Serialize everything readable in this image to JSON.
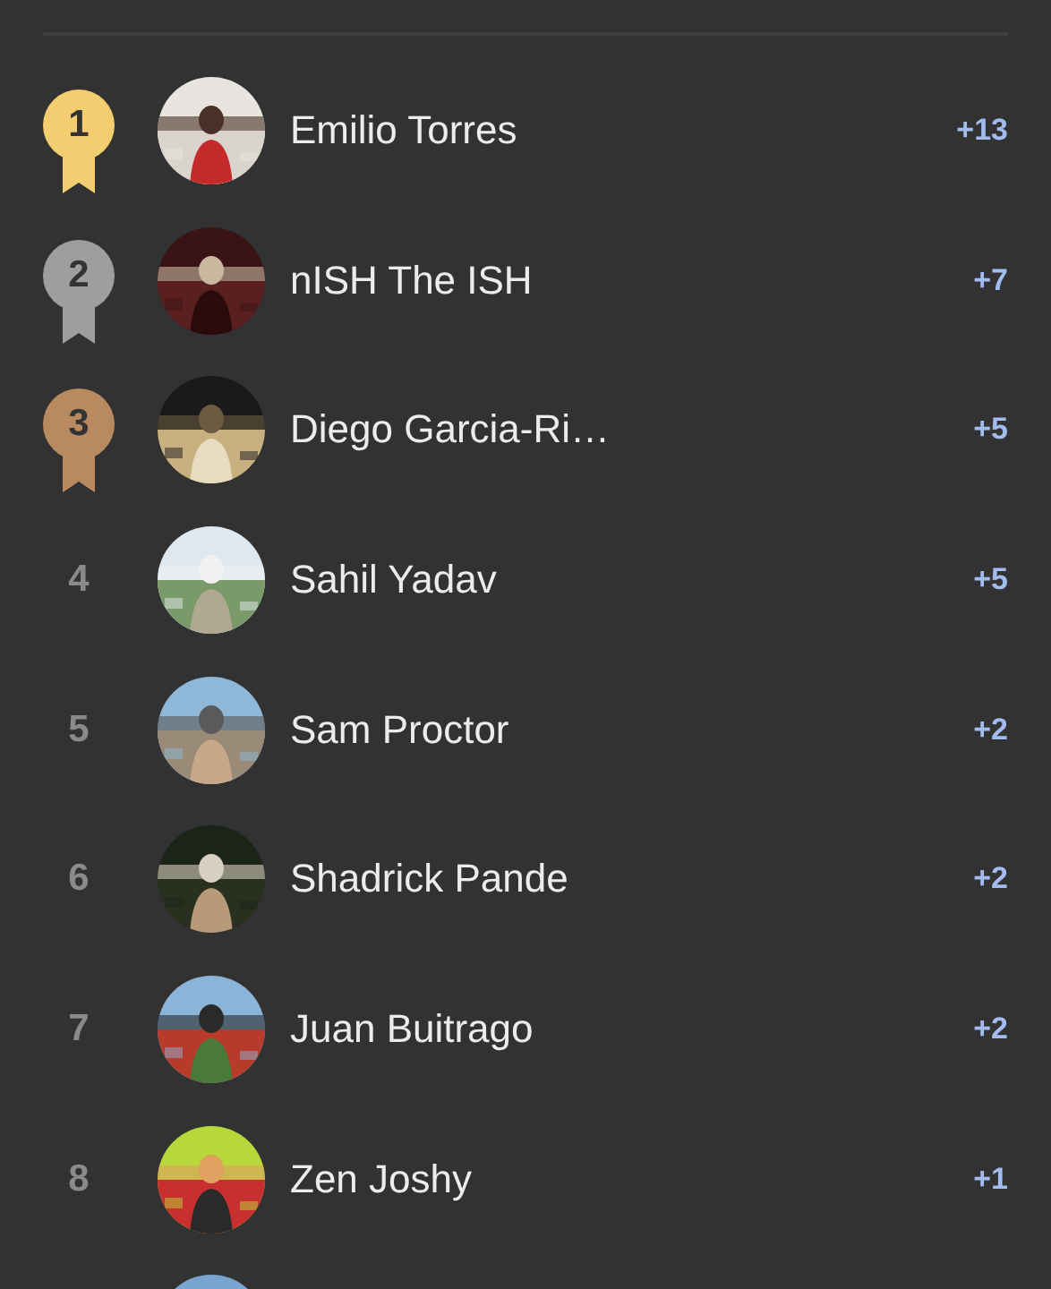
{
  "leaderboard": {
    "rows": [
      {
        "rank": "1",
        "kind": "medal",
        "color": "#f3cd70",
        "name": "Emilio Torres",
        "score": "+13",
        "avatar": {
          "kind": "picture"
        }
      },
      {
        "rank": "2",
        "kind": "medal",
        "color": "#9e9e9e",
        "name": "nISH The ISH",
        "score": "+7",
        "avatar": {
          "kind": "picture"
        }
      },
      {
        "rank": "3",
        "kind": "medal",
        "color": "#b98a5f",
        "name": "Diego Garcia-Ri…",
        "score": "+5",
        "avatar": {
          "kind": "picture"
        }
      },
      {
        "rank": "4",
        "kind": "plain",
        "name": "Sahil Yadav",
        "score": "+5",
        "avatar": {
          "kind": "picture"
        }
      },
      {
        "rank": "5",
        "kind": "plain",
        "name": "Sam Proctor",
        "score": "+2",
        "avatar": {
          "kind": "picture"
        }
      },
      {
        "rank": "6",
        "kind": "plain",
        "name": "Shadrick Pande",
        "score": "+2",
        "avatar": {
          "kind": "picture"
        }
      },
      {
        "rank": "7",
        "kind": "plain",
        "name": "Juan Buitrago",
        "score": "+2",
        "avatar": {
          "kind": "picture"
        }
      },
      {
        "rank": "8",
        "kind": "plain",
        "name": "Zen Joshy",
        "score": "+1",
        "avatar": {
          "kind": "picture"
        }
      },
      {
        "avatar": {
          "kind": "picture"
        }
      }
    ]
  }
}
